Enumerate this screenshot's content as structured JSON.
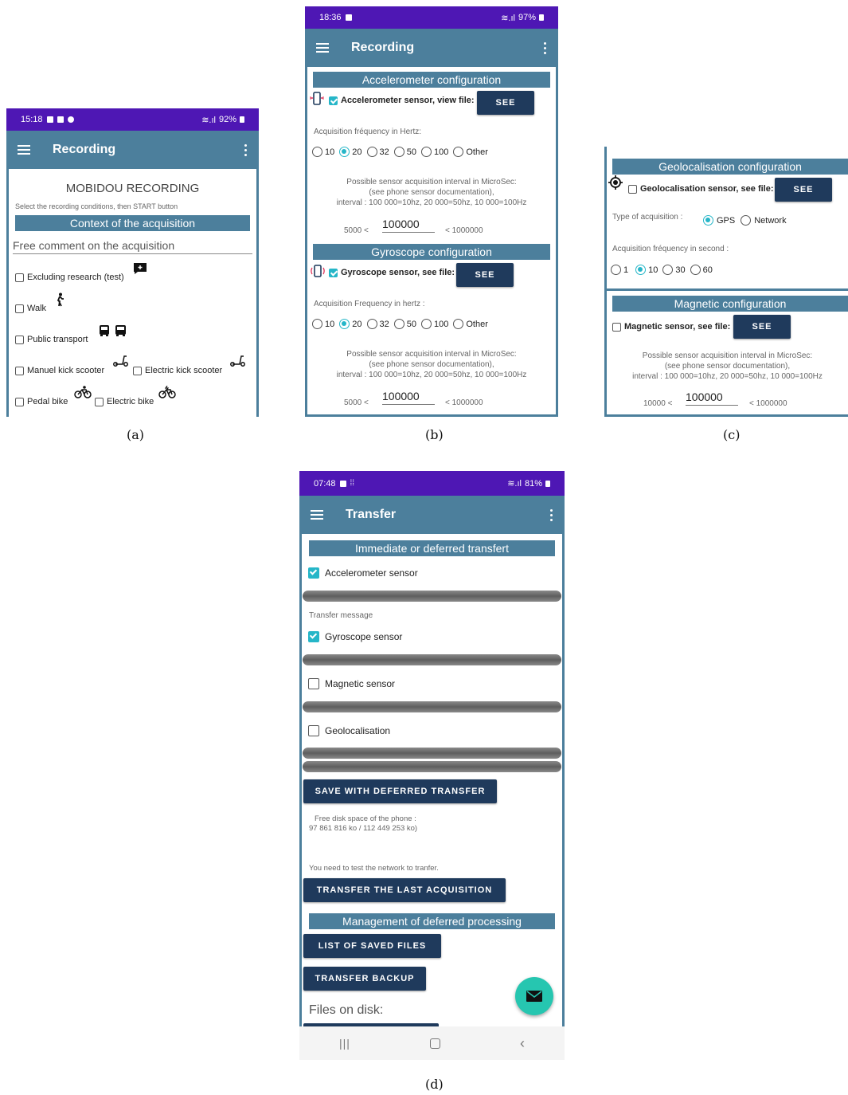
{
  "colors": {
    "status": "#4e17b4",
    "toolbar": "#4c7f9c",
    "accent": "#26b6c8",
    "button": "#1f3a5c"
  },
  "a": {
    "status": {
      "time": "15:18",
      "battery": "92%"
    },
    "title": "Recording",
    "heading": "MOBIDOU RECORDING",
    "hint": "Select the recording conditions, then START button",
    "section": "Context of the acquisition",
    "comment_placeholder": "Free comment on the acquisition",
    "options": [
      "Excluding research (test)",
      "Walk",
      "Public transport",
      "Manuel kick scooter",
      "Electric kick scooter",
      "Pedal bike",
      "Electric bike"
    ],
    "caption": "(a)"
  },
  "b": {
    "status": {
      "time": "18:36",
      "battery": "97%"
    },
    "title": "Recording",
    "acc": {
      "section": "Accelerometer configuration",
      "sensor": "Accelerometer sensor, view file:",
      "see": "SEE",
      "freq_label": "Acquisition fréquency in Hertz:",
      "freqs": [
        "10",
        "20",
        "32",
        "50",
        "100",
        "Other"
      ],
      "selected": "20",
      "info1": "Possible sensor acquisition interval in MicroSec:",
      "info2": "(see phone sensor documentation),",
      "info3": "interval : 100 000=10hz, 20 000=50hz, 10 000=100Hz",
      "min": "5000 <",
      "value": "100000",
      "max": "< 1000000"
    },
    "gyro": {
      "section": "Gyroscope configuration",
      "sensor": "Gyroscope sensor, see file:",
      "see": "SEE",
      "freq_label": "Acquisition Frequency in hertz :",
      "freqs": [
        "10",
        "20",
        "32",
        "50",
        "100",
        "Other"
      ],
      "selected": "20",
      "info1": "Possible sensor acquisition interval in MicroSec:",
      "info2": "(see phone sensor documentation),",
      "info3": "interval : 100 000=10hz, 20 000=50hz, 10 000=100Hz",
      "min": "5000 <",
      "value": "100000",
      "max": "< 1000000"
    },
    "caption": "(b)"
  },
  "c": {
    "geo": {
      "section": "Geolocalisation configuration",
      "sensor": "Geolocalisation sensor, see file:",
      "see": "SEE",
      "type_label": "Type of acquisition :",
      "types": [
        "GPS",
        "Network"
      ],
      "freq_label": "Acquisition fréquency in second :",
      "freqs": [
        "1",
        "10",
        "30",
        "60"
      ]
    },
    "mag": {
      "section": "Magnetic configuration",
      "sensor": "Magnetic sensor, see file:",
      "see": "SEE",
      "info1": "Possible sensor acquisition interval in MicroSec:",
      "info2": "(see phone sensor documentation),",
      "info3": "interval : 100 000=10hz, 20 000=50hz, 10 000=100Hz",
      "min": "10000 <",
      "value": "100000",
      "max": "< 1000000"
    },
    "caption": "(c)"
  },
  "d": {
    "status": {
      "time": "07:48",
      "battery": "81%"
    },
    "title": "Transfer",
    "section1": "Immediate or deferred transfert",
    "sensors": [
      "Accelerometer sensor",
      "Gyroscope sensor",
      "Magnetic sensor",
      "Geolocalisation"
    ],
    "transfer_msg": "Transfer message",
    "save_btn": "SAVE WITH DEFERRED TRANSFER",
    "disk1": "Free disk space of the phone :",
    "disk2": "97 861 816  ko / 112 449 253 ko)",
    "net_hint": "You need to test the network to tranfer.",
    "transfer_btn": "TRANSFER THE LAST ACQUISITION",
    "section2": "Management of deferred processing",
    "list_btn": "LIST OF SAVED FILES",
    "backup_btn": "TRANSFER BACKUP",
    "files": "Files on disk:",
    "caption": "(d)"
  }
}
